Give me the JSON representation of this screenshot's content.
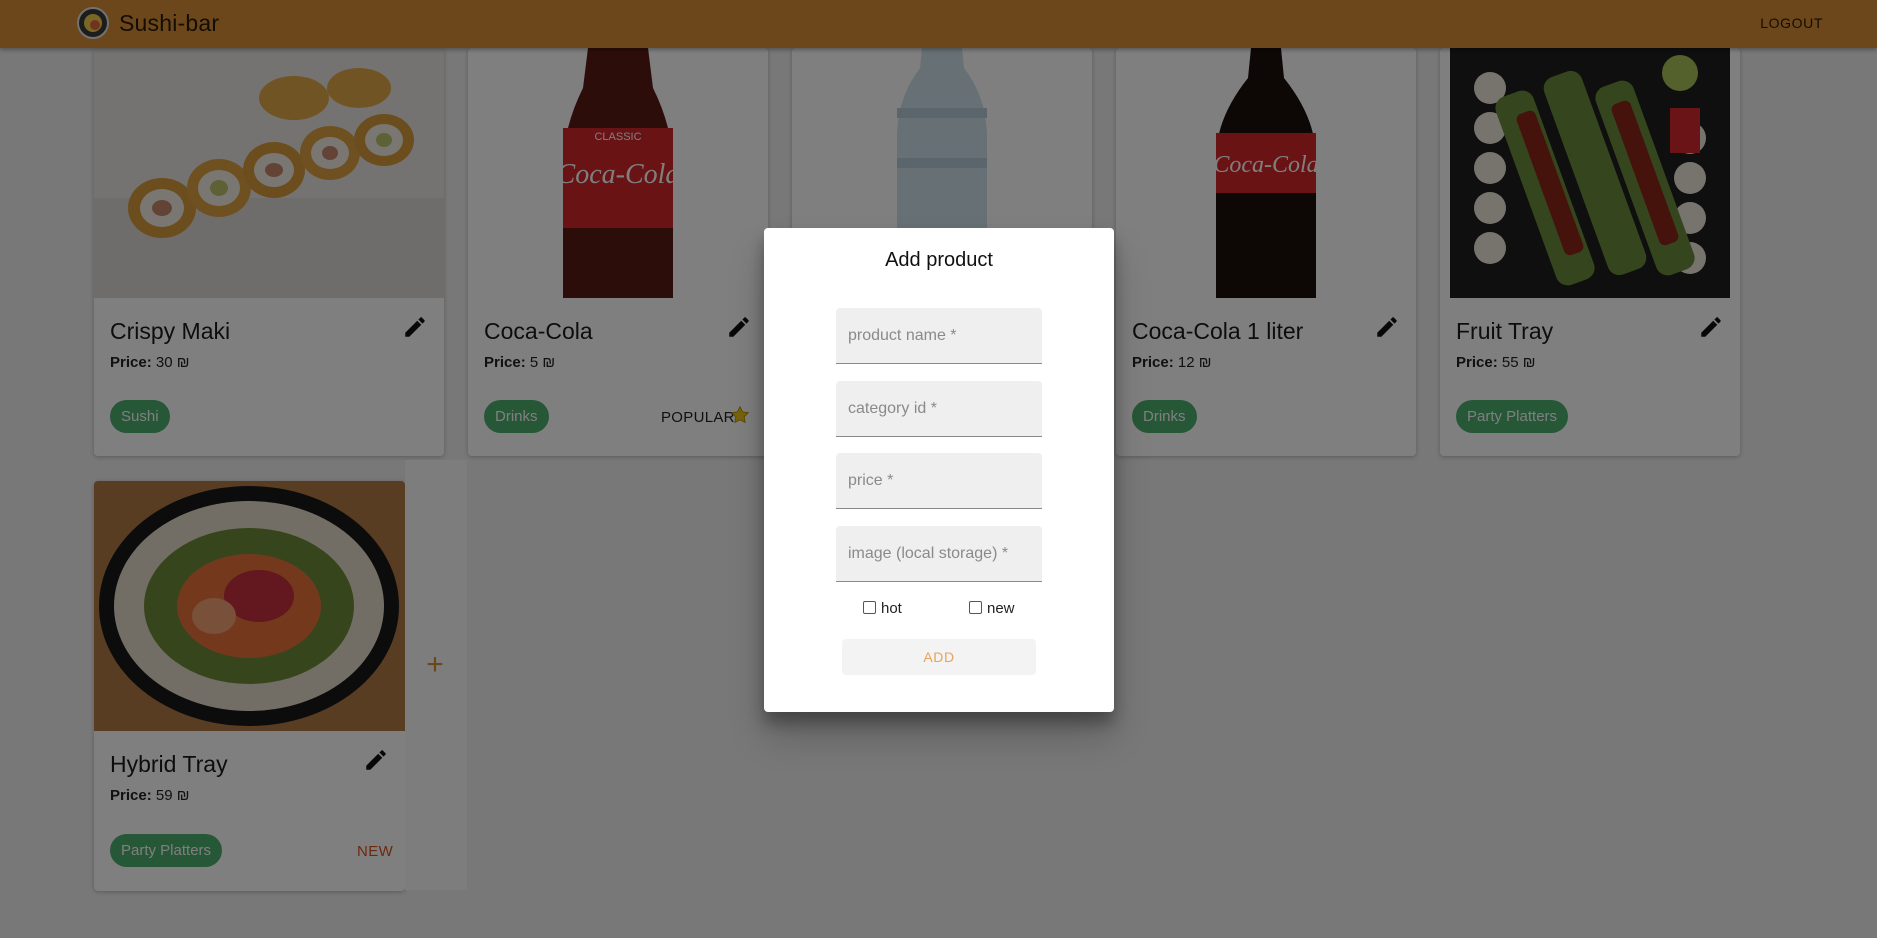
{
  "app": {
    "title": "Sushi-bar",
    "logout_label": "LOGOUT"
  },
  "price_label": "Price:",
  "products": [
    {
      "name": "Crispy Maki",
      "price": "30 ₪",
      "category": "Sushi",
      "image": "sushi-roll-photo"
    },
    {
      "name": "Coca-Cola",
      "price": "5 ₪",
      "category": "Drinks",
      "popular_label": "POPULAR",
      "image": "coca-cola-bottle-photo"
    },
    {
      "name": "",
      "price": "",
      "category": "",
      "image": "water-bottle-photo"
    },
    {
      "name": "Coca-Cola 1 liter",
      "price": "12 ₪",
      "category": "Drinks",
      "image": "coca-cola-1l-photo"
    },
    {
      "name": "Fruit Tray",
      "price": "55 ₪",
      "category": "Party Platters",
      "image": "fruit-tray-photo"
    },
    {
      "name": "Hybrid Tray",
      "price": "59 ₪",
      "category": "Party Platters",
      "new_label": "NEW",
      "image": "hybrid-tray-photo"
    }
  ],
  "add_card": {
    "icon": "plus-icon"
  },
  "dialog": {
    "title": "Add product",
    "fields": {
      "product_name": "product name *",
      "category_id": "category id *",
      "price": "price *",
      "image": "image (local storage) *"
    },
    "checkboxes": {
      "hot": "hot",
      "new": "new"
    },
    "add_label": "ADD"
  },
  "colors": {
    "appbar": "#d68f37",
    "chip": "#4caf6e",
    "new": "#d9501f",
    "accent": "#e8a35a"
  }
}
